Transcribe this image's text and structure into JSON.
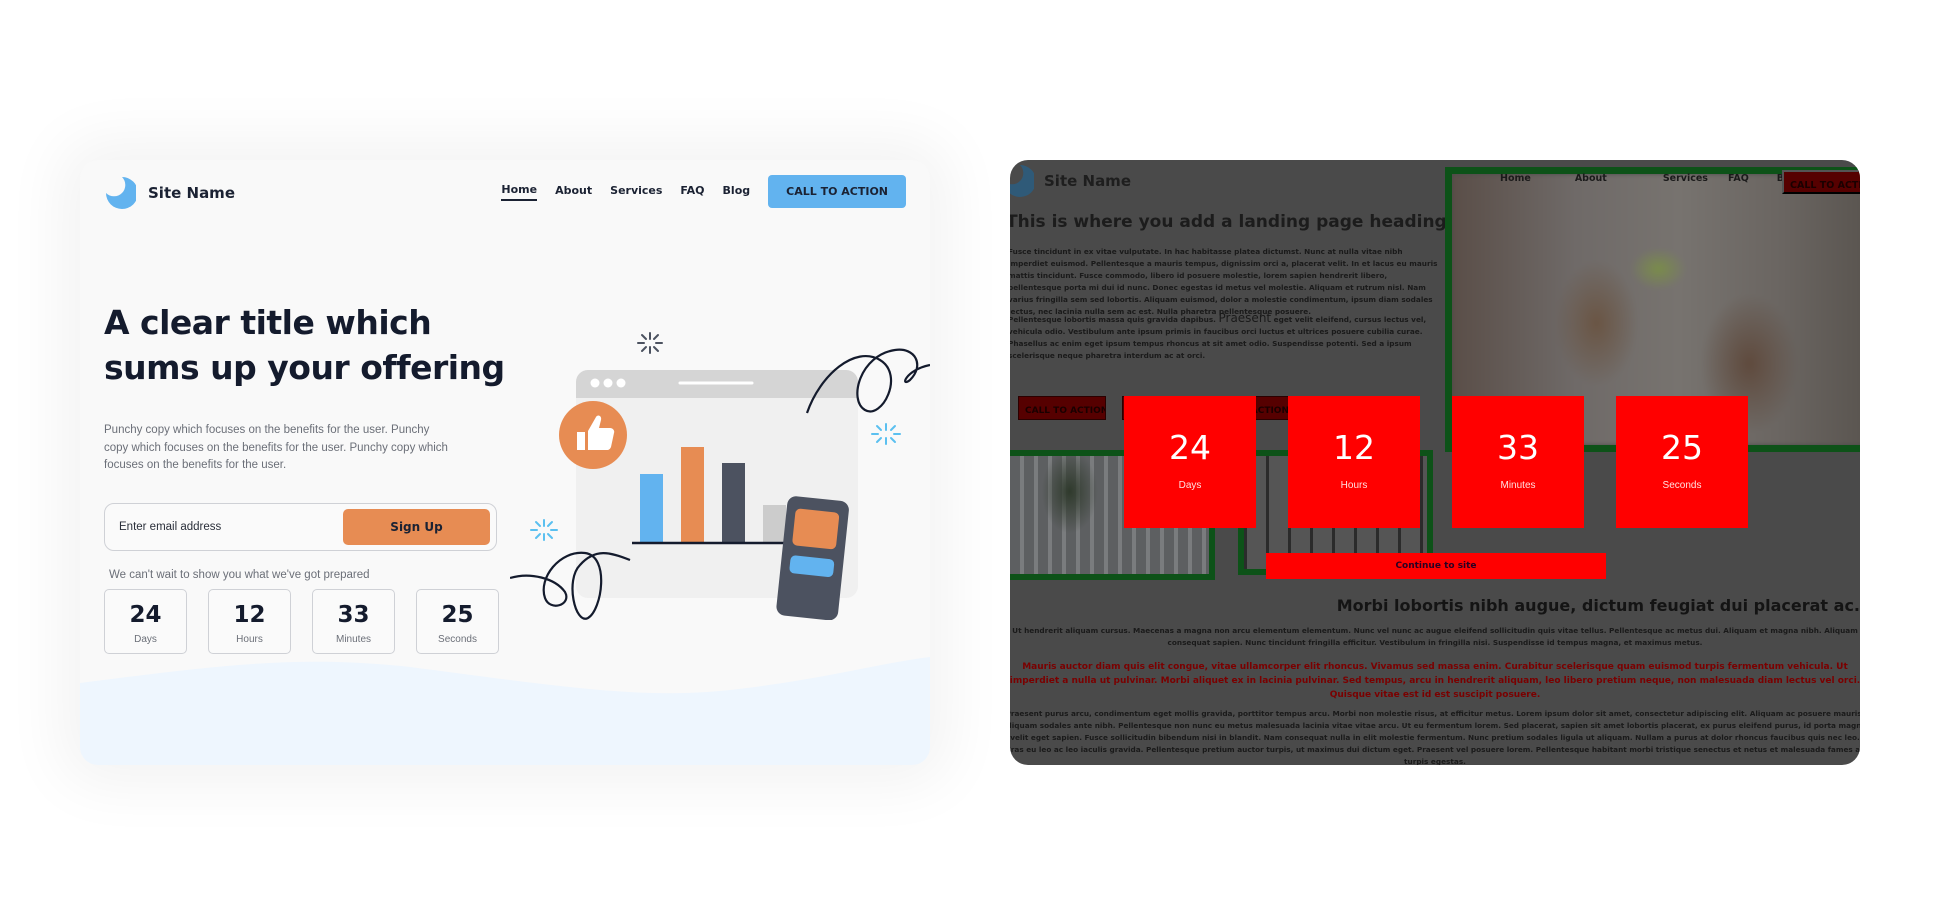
{
  "left_panel": {
    "logo": {
      "icon": "crescent-moon-icon",
      "name": "Site Name",
      "color": "#62b3ef"
    },
    "nav": {
      "items": [
        {
          "label": "Home",
          "active": true
        },
        {
          "label": "About",
          "active": false
        },
        {
          "label": "Services",
          "active": false
        },
        {
          "label": "FAQ",
          "active": false
        },
        {
          "label": "Blog",
          "active": false
        }
      ],
      "cta_label": "CALL TO ACTION"
    },
    "hero": {
      "title": "A clear title which sums up your offering",
      "copy": "Punchy copy which focuses on the benefits for the user. Punchy copy which focuses on the benefits for the user. Punchy copy which focuses on the benefits for the user."
    },
    "signup": {
      "email_placeholder": "Enter email address",
      "email_value": "",
      "button_label": "Sign Up"
    },
    "tagline": "We can't wait to show you what we've got prepared",
    "countdown": [
      {
        "value": "24",
        "label": "Days"
      },
      {
        "value": "12",
        "label": "Hours"
      },
      {
        "value": "33",
        "label": "Minutes"
      },
      {
        "value": "25",
        "label": "Seconds"
      }
    ],
    "illustration": {
      "description": "browser window with bar chart, thumbs-up badge, phone card, sparkles and squiggles",
      "icons": [
        "thumbs-up-icon",
        "sparkle-icon",
        "phone-icon"
      ],
      "bars": [
        {
          "relative_height": 0.68,
          "color": "#62b3ef"
        },
        {
          "relative_height": 0.95,
          "color": "#e78c53"
        },
        {
          "relative_height": 0.79,
          "color": "#4c5260"
        },
        {
          "relative_height": 0.37,
          "color": "#cccccc"
        }
      ]
    },
    "colors": {
      "accent_blue": "#62b3ef",
      "accent_orange": "#e78c53",
      "text_dark": "#141b2d"
    }
  },
  "right_panel": {
    "logo": {
      "icon": "crescent-moon-icon",
      "name": "Site Name"
    },
    "heading": "This is where you add a landing page heading",
    "paragraph_1": "Fusce tincidunt in ex vitae vulputate. In hac habitasse platea dictumst. Nunc at nulla vitae nibh imperdiet euismod. Pellentesque a mauris tempus, dignissim orci a, placerat velit. In et lacus eu mauris mattis tincidunt. Fusce commodo, libero id posuere molestie, lorem sapien hendrerit libero, pellentesque porta mi dui id nunc. Donec egestas id metus vel molestie. Aliquam et rutrum nisl. Nam varius fringilla sem sed lobortis. Aliquam euismod, dolor a molestie condimentum, ipsum diam sodales lectus, nec lacinia nulla sem ac est. Nulla pharetra pellentesque posuere.",
    "paragraph_2_pre": "Pellentesque lobortis massa quis gravida dapibus. ",
    "paragraph_2_big": "Praesent",
    "paragraph_2_post": " eget velit eleifend, cursus lectus vel, vehicula odio. Vestibulum ante ipsum primis in faucibus orci luctus et ultrices posuere cubilia curae. Phasellus ac enim eget ipsum tempus rhoncus at sit amet odio. Suspendisse potenti. Sed a ipsum scelerisque neque pharetra interdum ac at orci.",
    "nav": [
      "Home",
      "About",
      "Services",
      "FAQ",
      "Blog"
    ],
    "cta_label": "CALL TO ACTION",
    "cta_buttons": [
      "CALL TO ACTION",
      "CALL TO ACTION"
    ],
    "countdown": [
      {
        "value": "24",
        "label": "Days"
      },
      {
        "value": "12",
        "label": "Hours"
      },
      {
        "value": "33",
        "label": "Minutes"
      },
      {
        "value": "25",
        "label": "Seconds"
      }
    ],
    "continue_label": "Continue to site",
    "heading_2": "Morbi lobortis nibh augue, dictum feugiat dui placerat ac.",
    "centered_1": "Ut hendrerit aliquam cursus. Maecenas a magna non arcu elementum elementum. Nunc vel nunc ac augue eleifend sollicitudin quis vitae tellus. Pellentesque ac metus dui. Aliquam et magna nibh. Aliquam consequat sapien. Nunc tincidunt fringilla efficitur. Vestibulum in fringilla nisi. Suspendisse id tempus magna, et maximus metus.",
    "centered_red": "Mauris auctor diam quis elit congue, vitae ullamcorper elit rhoncus. Vivamus sed massa enim. Curabitur scelerisque quam euismod turpis fermentum vehicula. Ut imperdiet a nulla ut pulvinar. Morbi aliquet ex in lacinia pulvinar. Sed tempus, arcu in hendrerit aliquam, leo libero pretium neque, non malesuada diam lectus vel orci. Quisque vitae est id est suscipit posuere.",
    "centered_3": "Praesent purus arcu, condimentum eget mollis gravida, porttitor tempus arcu. Morbi non molestie risus, at efficitur metus. Lorem ipsum dolor sit amet, consectetur adipiscing elit. Aliquam ac posuere mauris. Aliquam sodales ante nibh. Pellentesque non nunc eu metus malesuada lacinia vitae vitae arcu. Ut eu fermentum lorem. Sed placerat, sapien sit amet lobortis placerat, ex purus eleifend purus, id porta magna velit eget sapien. Fusce sollicitudin bibendum nisi in blandit. Nam consequat nulla in elit molestie fermentum. Nunc pretium sodales ligula ut aliquam. Nullam a purus at dolor rhoncus faucibus quis nec leo. Cras eu leo ac leo iaculis gravida. Pellentesque pretium auctor turpis, ut maximus dui dictum eget. Praesent vel posuere lorem. Pellentesque habitant morbi tristique senectus et netus et malesuada fames ac turpis egestas.",
    "photos": [
      "office-high-five-photo",
      "office-plants-photo",
      "office-interior-photo"
    ],
    "colors": {
      "overlay": "#4a4a4a",
      "counter_bg": "#ff0000",
      "photo_border": "#0d5218",
      "cta_bg": "#560000",
      "red_text": "#7a0000"
    }
  }
}
